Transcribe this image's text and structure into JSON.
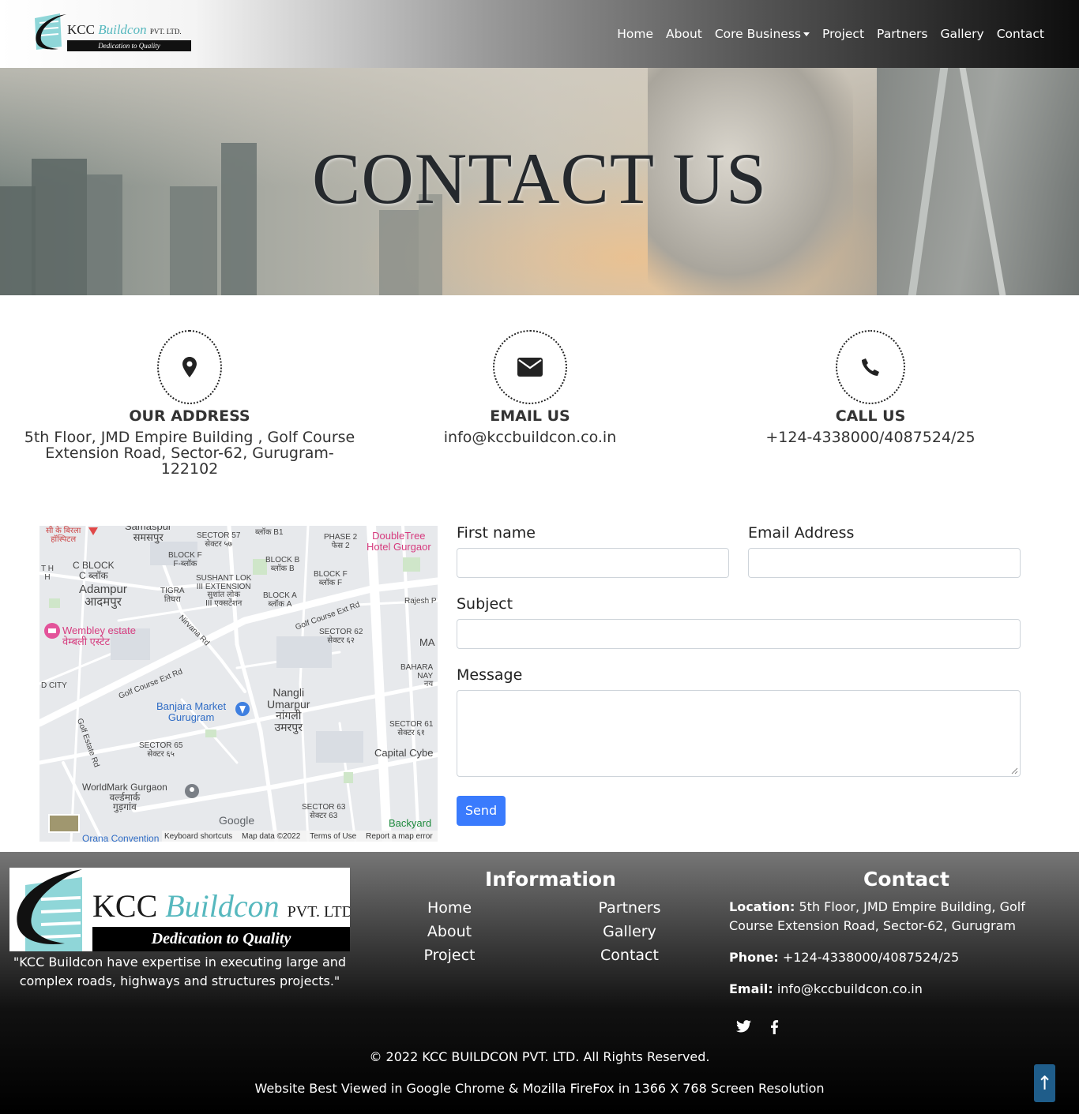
{
  "nav": {
    "logo_name": "KCC",
    "logo_brand": "Buildcon",
    "logo_suffix": "PVT. LTD.",
    "logo_tagline": "Dedication to Quality",
    "links": [
      "Home",
      "About",
      "Core Business",
      "Project",
      "Partners",
      "Gallery",
      "Contact"
    ]
  },
  "hero": {
    "title": "CONTACT US"
  },
  "info": {
    "address": {
      "title": "OUR ADDRESS",
      "text": "5th Floor, JMD Empire Building , Golf Course Extension Road, Sector-62, Gurugram-122102",
      "icon": "map-marker-icon"
    },
    "email": {
      "title": "EMAIL US",
      "text": "info@kccbuildcon.co.in",
      "icon": "envelope-icon"
    },
    "phone": {
      "title": "CALL US",
      "text": "+124-4338000/4087524/25",
      "icon": "phone-icon"
    }
  },
  "map": {
    "labels": {
      "samaspur": "Samaspur\nसमसपुर",
      "hospital": "सी के बिरला\nहॉस्पिटल",
      "sector57": "SECTOR 57\nसेक्टर ५७",
      "blockb1": "ब्लॉक B1",
      "phase2": "PHASE 2\nफेस 2",
      "doubletree": "DoubleTree\nHotel Gurgaor",
      "cblock": "C BLOCK\nC ब्लॉक",
      "blockf1": "BLOCK F\nF-ब्लॉक",
      "blockb": "BLOCK B\nब्लॉक B",
      "blockf2": "BLOCK F\nब्लॉक F",
      "th": "T H\nH",
      "adampur": "Adampur\nआदमपुर",
      "tigra": "TIGRA\nतिघरा",
      "sushant": "SUSHANT LOK\nIII EXTENSION\nसुशांत लोक\nIII एक्सटेंशन",
      "blocka": "BLOCK A\nब्लॉक A",
      "rajesh": "Rajesh P",
      "golfext1": "Golf Course Ext Rd",
      "wembley": "Wembley estate\nवेम्बली एस्टेट",
      "nirvana": "Nirvana Rd",
      "sector62": "SECTOR 62\nसेक्टर ६२",
      "ma": "MA",
      "bahara": "BAHARA\nNAY\nनय",
      "dcity": "D CITY",
      "golfext2": "Golf Course Ext Rd",
      "nangli": "Nangli\nUmarpur\nनांगली\nउमरपुर",
      "banjara": "Banjara Market\nGurugram",
      "sector61": "SECTOR 61\nसेक्टर ६१",
      "golfestate": "Golf Estate Rd",
      "sector65": "SECTOR 65\nसेक्टर ६५",
      "capital": "Capital Cybe",
      "worldmark": "WorldMark Gurgaon\nवर्ल्डमार्क\nगुड़गांव",
      "sector63": "SECTOR 63\nसेक्टर 63",
      "backyard": "Backyard",
      "orana": "Orana Convention",
      "google": "Google"
    },
    "footer": [
      "Keyboard shortcuts",
      "Map data ©2022",
      "Terms of Use",
      "Report a map error"
    ]
  },
  "form": {
    "first_name_label": "First name",
    "email_label": "Email Address",
    "subject_label": "Subject",
    "message_label": "Message",
    "send_label": "Send"
  },
  "footer": {
    "logo_name": "KCC",
    "logo_brand": "Buildcon",
    "logo_suffix": "PVT. LTD.",
    "logo_tagline": "Dedication to Quality",
    "quote": "\"KCC Buildcon have expertise in executing large and complex roads, highways and structures projects.\"",
    "info_heading": "Information",
    "links_left": [
      "Home",
      "About",
      "Project"
    ],
    "links_right": [
      "Partners",
      "Gallery",
      "Contact"
    ],
    "contact_heading": "Contact",
    "location_label": "Location:",
    "location_text": "5th Floor, JMD Empire Building, Golf Course Extension Road, Sector-62, Gurugram",
    "phone_label": "Phone:",
    "phone_text": "+124-4338000/4087524/25",
    "email_label": "Email:",
    "email_text": "info@kccbuildcon.co.in",
    "copyright": "© 2022 KCC BUILDCON PVT. LTD. All Rights Reserved.",
    "best_viewed": "Website Best Viewed in Google Chrome & Mozilla FireFox in 1366 X 768 Screen Resolution",
    "top_button": "↑"
  },
  "colors": {
    "accent": "#3a7bfd",
    "brand_teal": "#56b8be",
    "scroll_top": "#1f5d8a"
  }
}
